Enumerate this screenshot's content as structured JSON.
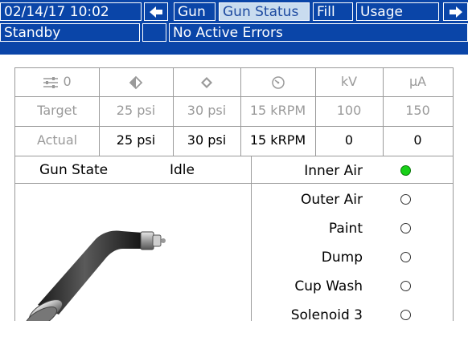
{
  "top_bar": {
    "datetime": "02/14/17 10:02",
    "tabs": [
      {
        "label": "Gun"
      },
      {
        "label": "Gun Status",
        "selected": true
      },
      {
        "label": "Fill"
      },
      {
        "label": "Usage"
      }
    ]
  },
  "status_bar": {
    "state": "Standby",
    "errors": "No Active Errors"
  },
  "table": {
    "header_icons": [
      "sliders-icon",
      "inner-air-icon",
      "outer-air-icon",
      "turbine-speed-icon"
    ],
    "header_slider_value": "0",
    "header_units": [
      "kV",
      "μA"
    ],
    "target": {
      "label": "Target",
      "values": [
        "25 psi",
        "30 psi",
        "15 kRPM",
        "100",
        "150"
      ]
    },
    "actual": {
      "label": "Actual",
      "values": [
        "25 psi",
        "30 psi",
        "15 kRPM",
        "0",
        "0"
      ]
    }
  },
  "gun_state": {
    "label": "Gun State",
    "value": "Idle"
  },
  "indicators": [
    {
      "label": "Inner Air",
      "on": true
    },
    {
      "label": "Outer Air",
      "on": false
    },
    {
      "label": "Paint",
      "on": false
    },
    {
      "label": "Dump",
      "on": false
    },
    {
      "label": "Cup Wash",
      "on": false
    },
    {
      "label": "Solenoid 3",
      "on": false
    }
  ],
  "colors": {
    "bar": "#0a45a8",
    "selected_tab": "#c9dcef",
    "indicator_on": "#18d018"
  }
}
